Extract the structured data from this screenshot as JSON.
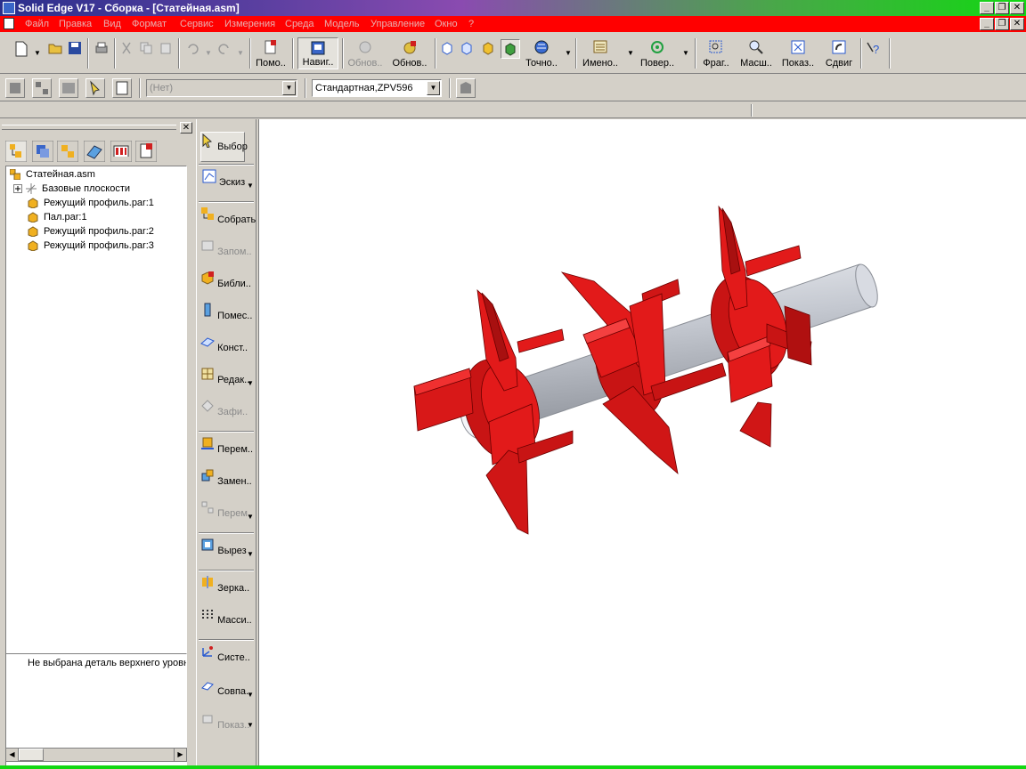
{
  "window": {
    "title": "Solid Edge V17 - Сборка - [Статейная.asm]",
    "buttons": [
      "_",
      "❐",
      "✕"
    ]
  },
  "menubar": {
    "items": [
      "Файл",
      "Правка",
      "Вид",
      "Формат",
      "Сервис",
      "Измерения",
      "Среда",
      "Модель",
      "Управление",
      "Окно",
      "?"
    ],
    "doc_buttons": [
      "_",
      "❐",
      "✕"
    ]
  },
  "toolbar": {
    "labeled": {
      "help": "Помо..",
      "navigator": "Навиг..",
      "update1": "Обнов..",
      "update2": "Обнов..",
      "view_point": "Точно..",
      "named": "Имено..",
      "rotate": "Повер..",
      "fragment": "Фраг..",
      "zoom": "Масш..",
      "fit": "Показ..",
      "pan": "Сдвиг"
    }
  },
  "toolbar2": {
    "layer_combo": "(Нет)",
    "style_combo": "Стандартная,ZPV596"
  },
  "tree": {
    "root": "Статейная.asm",
    "items": [
      "Базовые плоскости",
      "Режущий профиль.par:1",
      "Пал.par:1",
      "Режущий профиль.par:2",
      "Режущий профиль.par:3"
    ]
  },
  "info": {
    "text": "Не выбрана деталь верхнего уровня"
  },
  "commands": {
    "select": "Выбор",
    "sketch": "Эскиз",
    "assemble": "Собрать",
    "remember": "Запом..",
    "library": "Библи..",
    "place": "Помес..",
    "construct": "Конст..",
    "edit": "Редак..",
    "fix": "Зафи..",
    "move": "Перем..",
    "replace": "Замен..",
    "move2": "Перем..",
    "cutout": "Вырез",
    "mirror": "Зерка..",
    "array": "Масси..",
    "system": "Систе..",
    "coincide": "Совпа..",
    "show": "Показ.."
  },
  "colors": {
    "part_red": "#e21a1a",
    "shaft": "#c8ccd4"
  }
}
